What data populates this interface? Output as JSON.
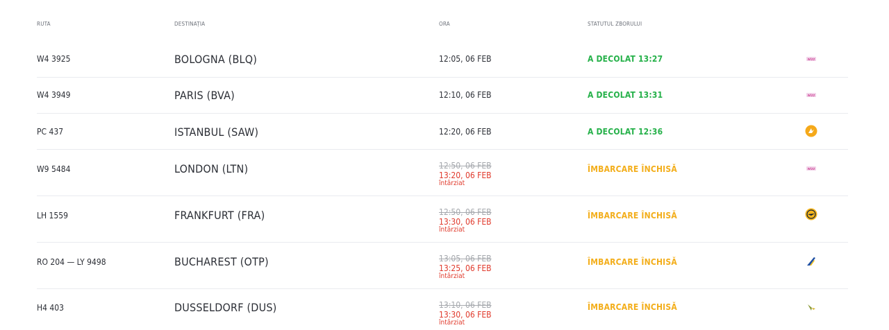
{
  "headers": {
    "route": "RUTA",
    "destination": "DESTINAȚIA",
    "time": "ORA",
    "status": "STATUTUL ZBORULUI"
  },
  "flights": [
    {
      "route": "W4 3925",
      "destination": "BOLOGNA (BLQ)",
      "time": "12:05, 06 FEB",
      "status": "A DECOLAT 13:27",
      "status_type": "departed",
      "airline_icon": "wizz-air-logo"
    },
    {
      "route": "W4 3949",
      "destination": "PARIS (BVA)",
      "time": "12:10, 06 FEB",
      "status": "A DECOLAT 13:31",
      "status_type": "departed",
      "airline_icon": "wizz-air-logo"
    },
    {
      "route": "PC 437",
      "destination": "ISTANBUL (SAW)",
      "time": "12:20, 06 FEB",
      "status": "A DECOLAT 12:36",
      "status_type": "departed",
      "airline_icon": "pegasus-logo"
    },
    {
      "route": "W9 5484",
      "destination": "LONDON (LTN)",
      "scheduled": "12:50, 06 FEB",
      "estimated": "13:20, 06 FEB",
      "delay_label": "întârziat",
      "status": "ÎMBARCARE ÎNCHISĂ",
      "status_type": "closed",
      "airline_icon": "wizz-air-logo"
    },
    {
      "route": "LH 1559",
      "destination": "FRANKFURT (FRA)",
      "scheduled": "12:50, 06 FEB",
      "estimated": "13:30, 06 FEB",
      "delay_label": "întârziat",
      "status": "ÎMBARCARE ÎNCHISĂ",
      "status_type": "closed",
      "airline_icon": "lufthansa-logo"
    },
    {
      "route": "RO 204 — LY 9498",
      "destination": "BUCHAREST (OTP)",
      "scheduled": "13:05, 06 FEB",
      "estimated": "13:25, 06 FEB",
      "delay_label": "întârziat",
      "status": "ÎMBARCARE ÎNCHISĂ",
      "status_type": "closed",
      "airline_icon": "tarom-logo"
    },
    {
      "route": "H4 403",
      "destination": "DUSSELDORF (DUS)",
      "scheduled": "13:10, 06 FEB",
      "estimated": "13:30, 06 FEB",
      "delay_label": "întârziat",
      "status": "ÎMBARCARE ÎNCHISĂ",
      "status_type": "closed",
      "airline_icon": "hisky-logo"
    }
  ],
  "colors": {
    "departed": "#26b14a",
    "closed": "#f3ae1b",
    "delayed": "#e0392b",
    "struck": "#a5a8ad"
  }
}
